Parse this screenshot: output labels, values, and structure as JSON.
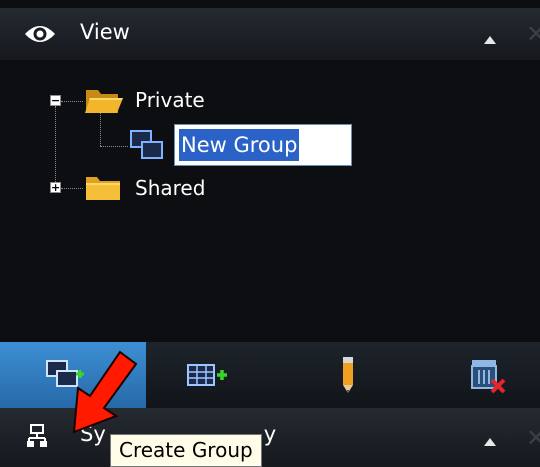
{
  "view_panel": {
    "title": "View",
    "tree": {
      "private_label": "Private",
      "new_group_value": "New Group",
      "shared_label": "Shared"
    }
  },
  "toolbar": {
    "buttons": [
      {
        "icon": "create-group-icon",
        "active": true
      },
      {
        "icon": "create-view-icon",
        "active": false
      },
      {
        "icon": "rename-pencil-icon",
        "active": false
      },
      {
        "icon": "delete-icon",
        "active": false
      }
    ]
  },
  "system_panel": {
    "title_start": "Sy",
    "title_end": "y"
  },
  "tooltip": {
    "text": "Create Group"
  },
  "colors": {
    "panel_background": "#0c0e12",
    "active_button": "#3d8fd4",
    "selection": "#2b62c8",
    "folder": "#f3b52c",
    "arrow": "#ff1a00"
  }
}
